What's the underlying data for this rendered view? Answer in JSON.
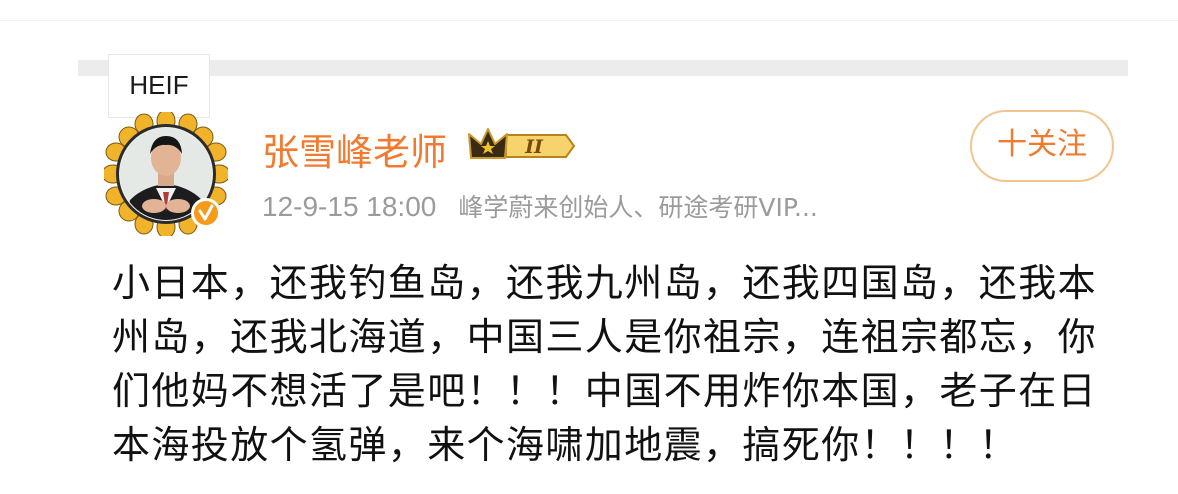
{
  "overlay": {
    "format_label": "HEIF"
  },
  "post": {
    "author": {
      "name": "张雪峰老师",
      "vip_badge": {
        "icon": "crown-icon",
        "level": "II"
      },
      "avatar_icon": "avatar-photo",
      "verified_icon": "verified-badge-icon"
    },
    "timestamp": "12-9-15 18:00",
    "source": "峰学蔚来创始人、研途考研VIP...",
    "follow_label": "十关注",
    "content_lines": [
      "小日本，还我钓鱼岛，还我九州岛，还我四国岛，还我本",
      "州岛，还我北海道，中国三人是你祖宗，连祖宗都忘，你",
      "们他妈不想活了是吧！！！中国不用炸你本国，老子在日",
      "本海投放个氢弹，来个海啸加地震，搞死你！！！！"
    ]
  },
  "colors": {
    "accent_orange": "#f27a2e",
    "follow_border": "#f2c58f",
    "meta_gray": "#9b9b9b",
    "text": "#111111"
  }
}
